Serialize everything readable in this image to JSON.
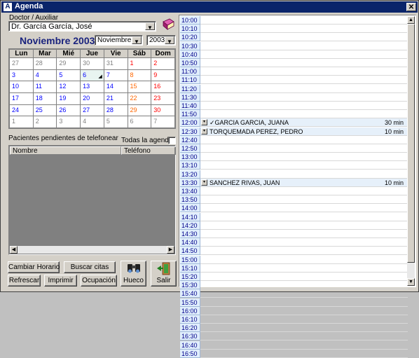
{
  "window": {
    "title": "Agenda",
    "close": "✕"
  },
  "doctor": {
    "label": "Doctor / Auxiliar",
    "value": "Dr. García García, José"
  },
  "calendar": {
    "title": "Noviembre 2003",
    "month_select": "Noviembre",
    "year_select": "2003",
    "days": [
      "Lun",
      "Mar",
      "Mié",
      "Jue",
      "Vie",
      "Sáb",
      "Dom"
    ],
    "weeks": [
      [
        "27",
        "28",
        "29",
        "30",
        "31",
        "1",
        "2"
      ],
      [
        "3",
        "4",
        "5",
        "6",
        "7",
        "8",
        "9"
      ],
      [
        "10",
        "11",
        "12",
        "13",
        "14",
        "15",
        "16"
      ],
      [
        "17",
        "18",
        "19",
        "20",
        "21",
        "22",
        "23"
      ],
      [
        "24",
        "25",
        "26",
        "27",
        "28",
        "29",
        "30"
      ],
      [
        "1",
        "2",
        "3",
        "4",
        "5",
        "6",
        "7"
      ]
    ],
    "today_mark": "◢"
  },
  "pending": {
    "label": "Pacientes pendientes de telefonear",
    "all_agendas_label": "Todas la agendas",
    "columns": [
      "Nombre",
      "Teléfono"
    ],
    "scroll_left": "◀",
    "scroll_right": "▶"
  },
  "buttons": {
    "cambiar_horario": "Cambiar Horario",
    "buscar_citas": "Buscar citas",
    "refrescar": "Refrescar",
    "imprimir": "Imprimir",
    "ocupacion": "Ocupación",
    "hueco": "Hueco",
    "salir": "Salir"
  },
  "agenda": {
    "dropdown_glyph": "▾",
    "slots": [
      {
        "time": "10:00"
      },
      {
        "time": "10:10"
      },
      {
        "time": "10:20"
      },
      {
        "time": "10:30"
      },
      {
        "time": "10:40"
      },
      {
        "time": "10:50"
      },
      {
        "time": "11:00"
      },
      {
        "time": "11:10"
      },
      {
        "time": "11:20"
      },
      {
        "time": "11:30"
      },
      {
        "time": "11:40"
      },
      {
        "time": "11:50"
      },
      {
        "time": "12:00",
        "patient": "✓GARCIA GARCIA, JUANA",
        "duration": "30 min"
      },
      {
        "time": "12:30",
        "patient": "TORQUEMADA PEREZ, PEDRO",
        "duration": "10 min"
      },
      {
        "time": "12:40"
      },
      {
        "time": "12:50"
      },
      {
        "time": "13:00"
      },
      {
        "time": "13:10"
      },
      {
        "time": "13:20"
      },
      {
        "time": "13:30",
        "patient": "SANCHEZ RIVAS, JUAN",
        "duration": "10 min"
      },
      {
        "time": "13:40"
      },
      {
        "time": "13:50"
      },
      {
        "time": "14:00"
      },
      {
        "time": "14:10"
      },
      {
        "time": "14:20"
      },
      {
        "time": "14:30"
      },
      {
        "time": "14:40"
      },
      {
        "time": "14:50"
      },
      {
        "time": "15:00"
      },
      {
        "time": "15:10"
      },
      {
        "time": "15:20"
      },
      {
        "time": "15:30"
      },
      {
        "time": "15:40"
      },
      {
        "time": "15:50"
      },
      {
        "time": "16:00"
      },
      {
        "time": "16:10"
      },
      {
        "time": "16:20"
      },
      {
        "time": "16:30"
      },
      {
        "time": "16:40"
      },
      {
        "time": "16:50"
      }
    ],
    "scroll_up": "▲",
    "scroll_down": "▼"
  },
  "colors": {
    "title_bar": "#0a246a",
    "month_title": "#1a237e",
    "time_cell": "#e0eefc"
  }
}
